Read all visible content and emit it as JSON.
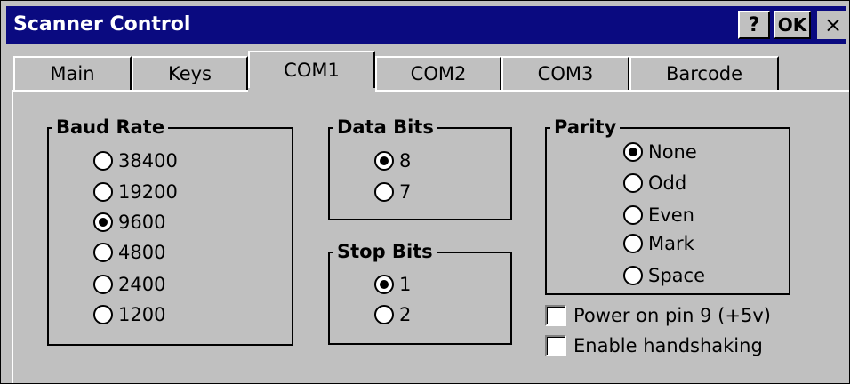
{
  "window": {
    "title": "Scanner Control",
    "help_label": "?",
    "ok_label": "OK",
    "close_label": "×"
  },
  "tabs": [
    {
      "label": "Main"
    },
    {
      "label": "Keys"
    },
    {
      "label": "COM1",
      "active": true
    },
    {
      "label": "COM2"
    },
    {
      "label": "COM3"
    },
    {
      "label": "Barcode"
    }
  ],
  "baud_rate": {
    "title": "Baud Rate",
    "options": [
      {
        "label": "38400",
        "selected": false
      },
      {
        "label": "19200",
        "selected": false
      },
      {
        "label": "9600",
        "selected": true
      },
      {
        "label": "4800",
        "selected": false
      },
      {
        "label": "2400",
        "selected": false
      },
      {
        "label": "1200",
        "selected": false
      }
    ]
  },
  "data_bits": {
    "title": "Data Bits",
    "options": [
      {
        "label": "8",
        "selected": true
      },
      {
        "label": "7",
        "selected": false
      }
    ]
  },
  "stop_bits": {
    "title": "Stop Bits",
    "options": [
      {
        "label": "1",
        "selected": true
      },
      {
        "label": "2",
        "selected": false
      }
    ]
  },
  "parity": {
    "title": "Parity",
    "options": [
      {
        "label": "None",
        "selected": true
      },
      {
        "label": "Odd",
        "selected": false
      },
      {
        "label": "Even",
        "selected": false
      },
      {
        "label": "Mark",
        "selected": false
      },
      {
        "label": "Space",
        "selected": false
      }
    ]
  },
  "checkboxes": {
    "power_pin9": {
      "label": "Power on pin 9 (+5v)",
      "checked": false
    },
    "handshaking": {
      "label": "Enable handshaking",
      "checked": false
    }
  }
}
